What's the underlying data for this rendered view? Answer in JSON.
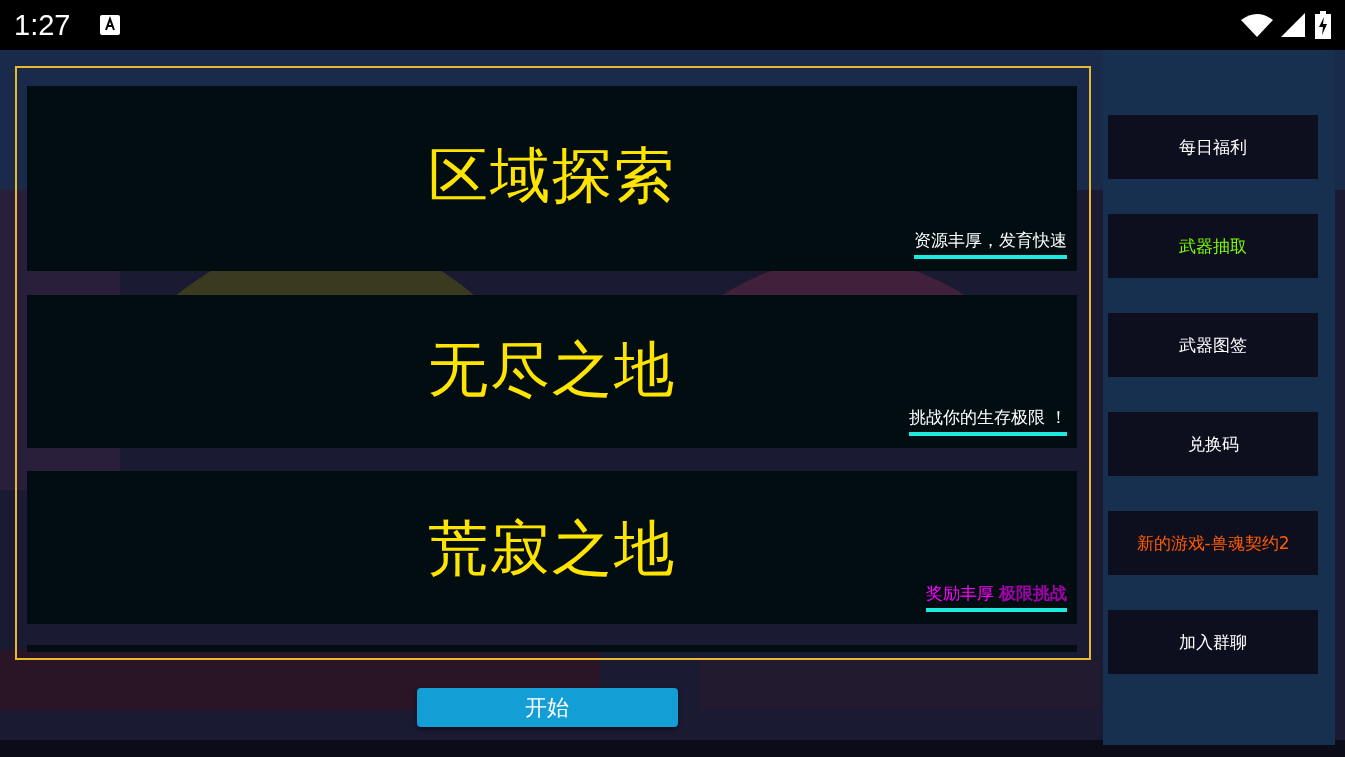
{
  "status_bar": {
    "time": "1:27"
  },
  "modes": [
    {
      "title": "区域探索",
      "subtitle": "资源丰厚，发育快速",
      "color": "#ffffff"
    },
    {
      "title": "无尽之地",
      "subtitle": "挑战你的生存极限 ！",
      "color": "#ffffff"
    },
    {
      "title": "荒寂之地",
      "subtitle": "奖励丰厚 **极限挑战**",
      "color": "#ff00ff"
    }
  ],
  "start_button": "开始",
  "sidebar": {
    "items": [
      {
        "label": "每日福利",
        "color": "#ffffff"
      },
      {
        "label": "武器抽取",
        "color": "#7cfc00"
      },
      {
        "label": "武器图签",
        "color": "#ffffff"
      },
      {
        "label": "兑换码",
        "color": "#ffffff"
      },
      {
        "label": "新的游戏-兽魂契约2",
        "color": "#ff5a00"
      },
      {
        "label": "加入群聊",
        "color": "#ffffff"
      }
    ]
  }
}
